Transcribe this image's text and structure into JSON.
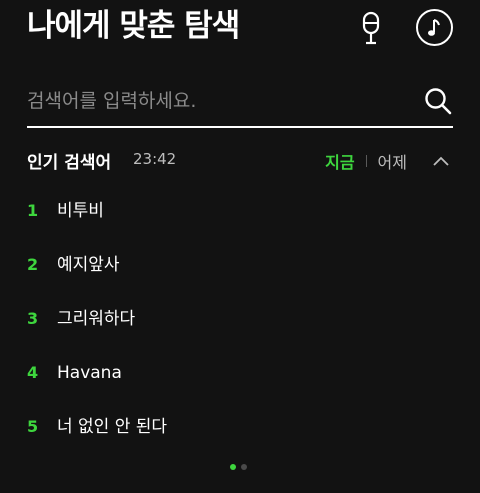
{
  "header": {
    "title": "나에게 맞춘 탐색",
    "mic_icon": "microphone-icon",
    "music_icon": "music-note-icon"
  },
  "search": {
    "placeholder": "검색어를 입력하세요.",
    "value": "",
    "icon": "search-icon"
  },
  "trending": {
    "title": "인기 검색어",
    "time": "23:42",
    "tabs": {
      "now": "지금",
      "yesterday": "어제"
    },
    "collapse_icon": "chevron-up-icon",
    "items": [
      {
        "rank": "1",
        "text": "비투비"
      },
      {
        "rank": "2",
        "text": "예지앞사"
      },
      {
        "rank": "3",
        "text": "그리워하다"
      },
      {
        "rank": "4",
        "text": "Havana"
      },
      {
        "rank": "5",
        "text": "너 없인 안 된다"
      }
    ]
  },
  "pager": {
    "count": 2,
    "active": 0
  },
  "colors": {
    "background": "#121212",
    "accent": "#3ed63e",
    "text": "#ffffff",
    "muted": "#bdbdbd"
  }
}
